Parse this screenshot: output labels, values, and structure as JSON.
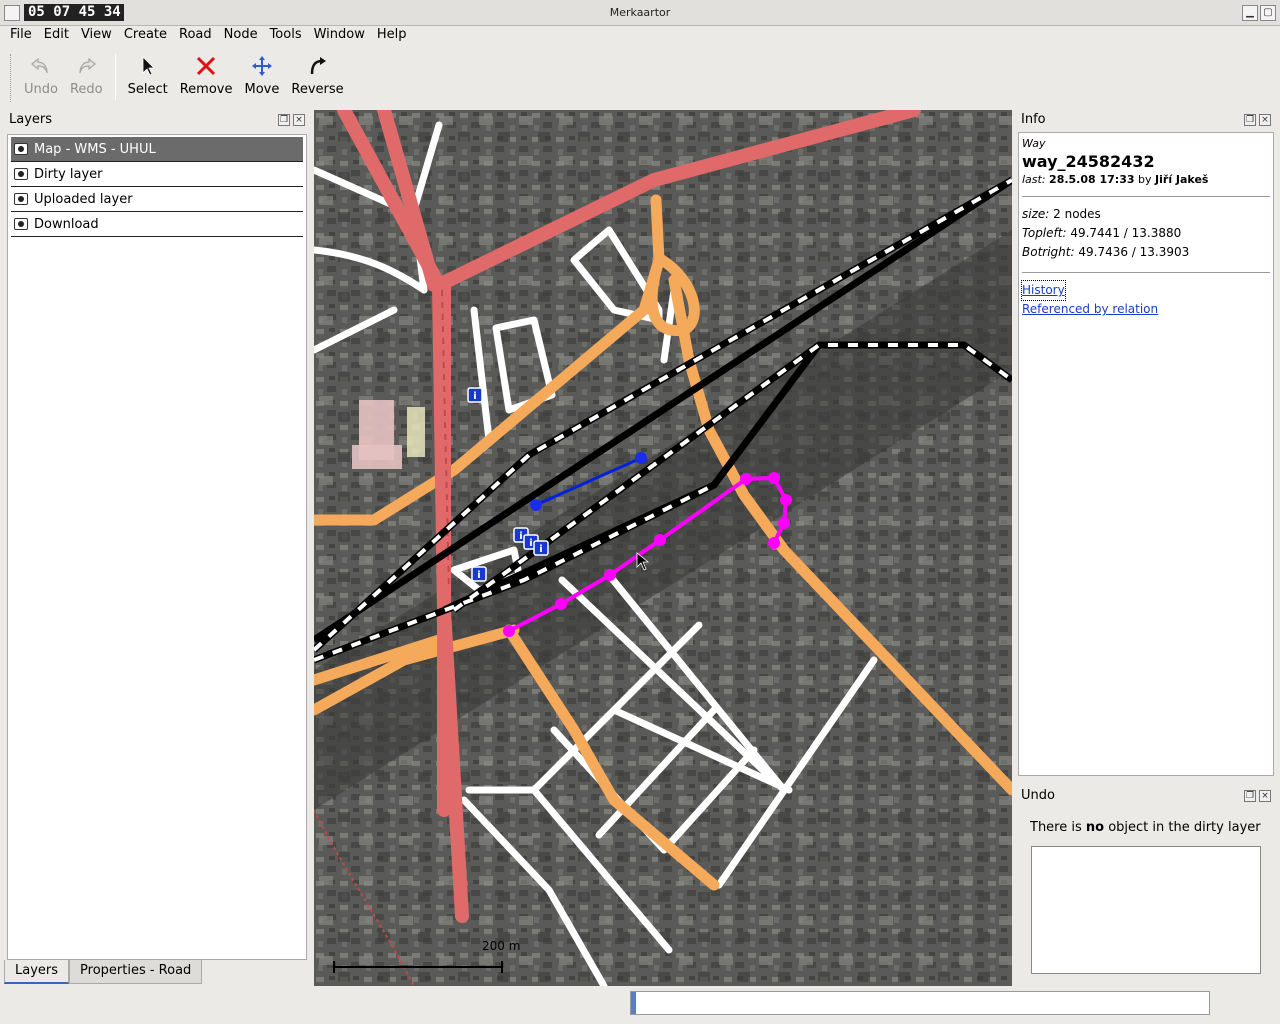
{
  "window": {
    "title": "Merkaartor",
    "clock": "05 07 45 34"
  },
  "menu": [
    "File",
    "Edit",
    "View",
    "Create",
    "Road",
    "Node",
    "Tools",
    "Window",
    "Help"
  ],
  "toolbar": {
    "undo": "Undo",
    "redo": "Redo",
    "select": "Select",
    "remove": "Remove",
    "move": "Move",
    "reverse": "Reverse"
  },
  "layers": {
    "title": "Layers",
    "items": [
      {
        "label": "Map - WMS - UHUL",
        "selected": true
      },
      {
        "label": "Dirty layer",
        "selected": false
      },
      {
        "label": "Uploaded layer",
        "selected": false
      },
      {
        "label": "Download",
        "selected": false
      }
    ]
  },
  "tabs": {
    "layers": "Layers",
    "properties": "Properties - Road"
  },
  "map": {
    "scale_label": "200 m",
    "icons": {
      "info": "info-marker-icon"
    },
    "colors": {
      "primary_road": "#e06a6a",
      "secondary_road": "#f5a95a",
      "residential": "#ffffff",
      "railway": "#000000",
      "selected_way": "#ff00ff",
      "new_way": "#0000ee"
    }
  },
  "info": {
    "title": "Info",
    "kind": "Way",
    "name": "way_24582432",
    "last_prefix": "last:",
    "last_date": "28.5.08 17:33",
    "by": "by",
    "author": "Jiří Jakeš",
    "size_label": "size:",
    "size_value": "2 nodes",
    "topleft_label": "Topleft:",
    "topleft_value": "49.7441 / 13.3880",
    "botright_label": "Botright:",
    "botright_value": "49.7436 / 13.3903",
    "history_link": "History",
    "relation_link": "Referenced by relation"
  },
  "undo": {
    "title": "Undo",
    "msg_prefix": "There is ",
    "msg_bold": "no",
    "msg_suffix": " object in the dirty layer"
  }
}
